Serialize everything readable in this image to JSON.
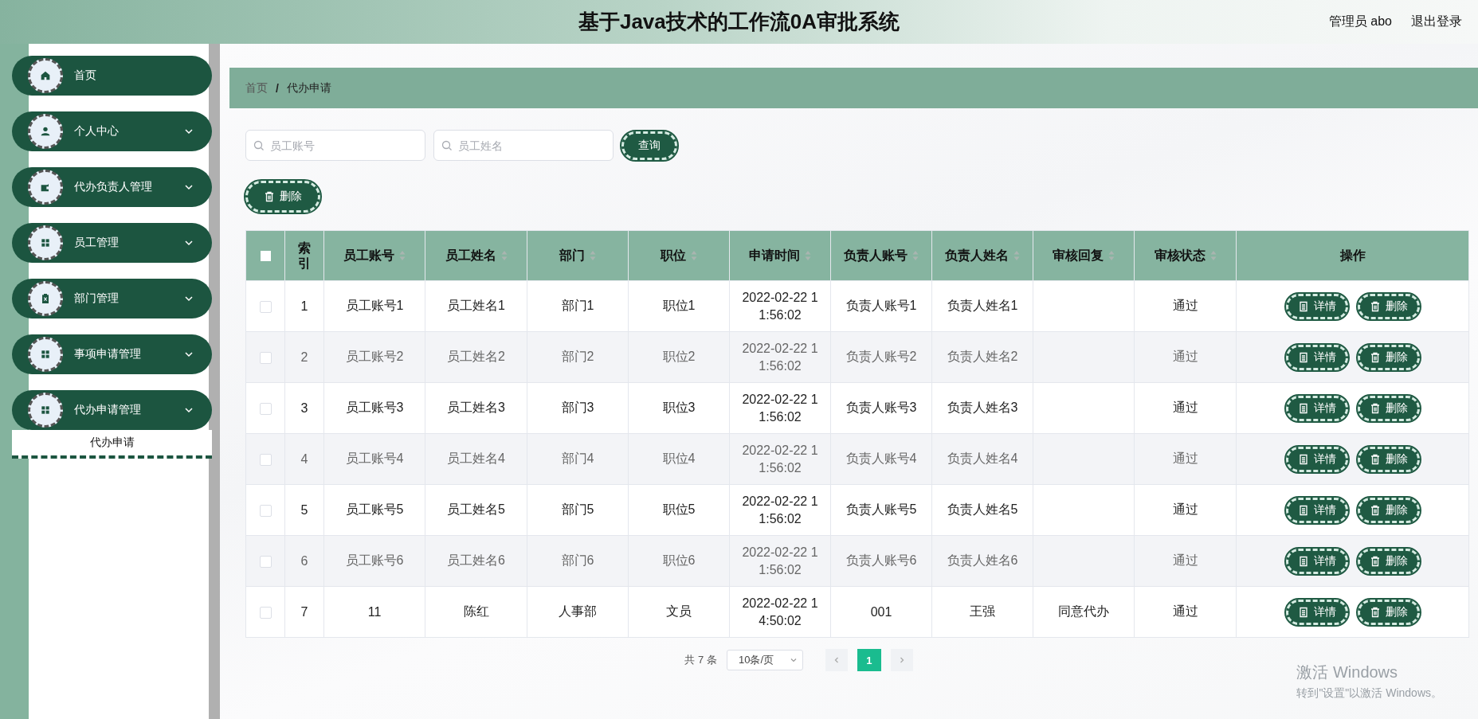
{
  "header": {
    "title": "基于Java技术的工作流0A审批系统",
    "user": "管理员 abo",
    "logout": "退出登录"
  },
  "sidebar": {
    "items": [
      {
        "label": "首页",
        "kind": "link"
      },
      {
        "label": "个人中心",
        "kind": "submenu"
      },
      {
        "label": "代办负责人管理",
        "kind": "submenu"
      },
      {
        "label": "员工管理",
        "kind": "submenu"
      },
      {
        "label": "部门管理",
        "kind": "submenu"
      },
      {
        "label": "事项申请管理",
        "kind": "submenu"
      },
      {
        "label": "代办申请管理",
        "kind": "submenu",
        "children": [
          {
            "label": "代办申请",
            "selected": true
          }
        ]
      }
    ]
  },
  "breadcrumb": {
    "items": [
      "首页",
      "代办申请"
    ],
    "separator": "/"
  },
  "search": {
    "fields": [
      {
        "placeholder": "员工账号"
      },
      {
        "placeholder": "员工姓名"
      }
    ],
    "button": "查询"
  },
  "delete_button": "删除",
  "table": {
    "header_checked": false,
    "columns": [
      {
        "label": "索引",
        "sortable": false
      },
      {
        "label": "员工账号",
        "sortable": true
      },
      {
        "label": "员工姓名",
        "sortable": true
      },
      {
        "label": "部门",
        "sortable": true
      },
      {
        "label": "职位",
        "sortable": true
      },
      {
        "label": "申请时间",
        "sortable": true
      },
      {
        "label": "负责人账号",
        "sortable": true
      },
      {
        "label": "负责人姓名",
        "sortable": true
      },
      {
        "label": "审核回复",
        "sortable": true
      },
      {
        "label": "审核状态",
        "sortable": true
      },
      {
        "label": "操作",
        "sortable": false
      }
    ],
    "rows": [
      {
        "checked": false,
        "cells": [
          "1",
          "员工账号1",
          "员工姓名1",
          "部门1",
          "职位1",
          "2022-02-22 11:56:02",
          "负责人账号1",
          "负责人姓名1",
          "",
          "通过"
        ],
        "actions": [
          "详情",
          "删除"
        ]
      },
      {
        "checked": false,
        "cells": [
          "2",
          "员工账号2",
          "员工姓名2",
          "部门2",
          "职位2",
          "2022-02-22 11:56:02",
          "负责人账号2",
          "负责人姓名2",
          "",
          "通过"
        ],
        "actions": [
          "详情",
          "删除"
        ]
      },
      {
        "checked": false,
        "cells": [
          "3",
          "员工账号3",
          "员工姓名3",
          "部门3",
          "职位3",
          "2022-02-22 11:56:02",
          "负责人账号3",
          "负责人姓名3",
          "",
          "通过"
        ],
        "actions": [
          "详情",
          "删除"
        ]
      },
      {
        "checked": false,
        "cells": [
          "4",
          "员工账号4",
          "员工姓名4",
          "部门4",
          "职位4",
          "2022-02-22 11:56:02",
          "负责人账号4",
          "负责人姓名4",
          "",
          "通过"
        ],
        "actions": [
          "详情",
          "删除"
        ]
      },
      {
        "checked": false,
        "cells": [
          "5",
          "员工账号5",
          "员工姓名5",
          "部门5",
          "职位5",
          "2022-02-22 11:56:02",
          "负责人账号5",
          "负责人姓名5",
          "",
          "通过"
        ],
        "actions": [
          "详情",
          "删除"
        ]
      },
      {
        "checked": false,
        "cells": [
          "6",
          "员工账号6",
          "员工姓名6",
          "部门6",
          "职位6",
          "2022-02-22 11:56:02",
          "负责人账号6",
          "负责人姓名6",
          "",
          "通过"
        ],
        "actions": [
          "详情",
          "删除"
        ]
      },
      {
        "checked": false,
        "cells": [
          "7",
          "11",
          "陈红",
          "人事部",
          "文员",
          "2022-02-22 14:50:02",
          "001",
          "王强",
          "同意代办",
          "通过"
        ],
        "actions": [
          "详情",
          "删除"
        ]
      }
    ]
  },
  "pagination": {
    "total": "共 7 条",
    "page_size": "10条/页",
    "pages": [
      {
        "label": "1",
        "selected": true
      }
    ]
  },
  "os_notice": {
    "title": "激活 Windows",
    "text": "转到\"设置\"以激活 Windows。"
  }
}
